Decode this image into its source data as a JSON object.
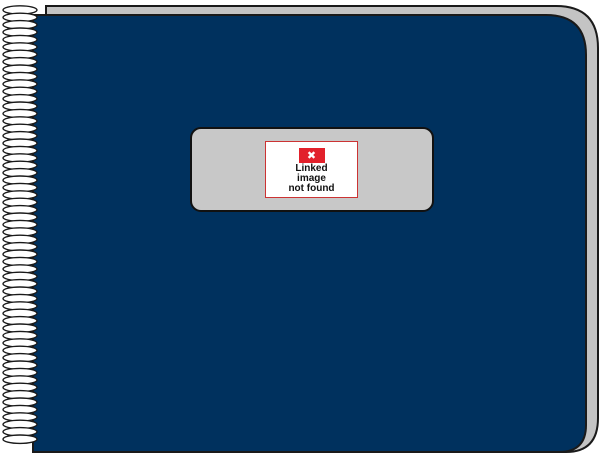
{
  "notebook": {
    "cover_color": "#00315e",
    "back_cover_color": "#c4c4c4",
    "outline_color": "#1a1a1a",
    "coil_color": "#ffffff"
  },
  "label": {
    "fill_color": "#c8c8c8",
    "broken_image": {
      "icon": "broken-image-x-icon",
      "icon_glyph": "✖",
      "text": "Linked\nimage\nnot found"
    }
  }
}
